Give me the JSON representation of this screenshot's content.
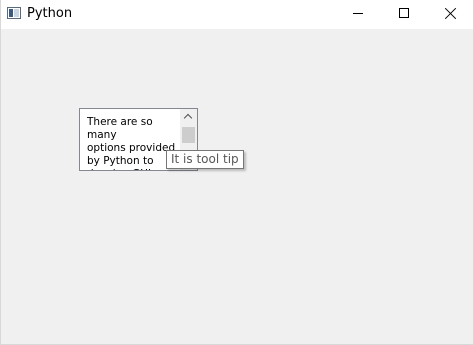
{
  "window": {
    "title": "Python",
    "icon": "window-app-icon"
  },
  "titlebar_controls": {
    "minimize_icon": "minimize-icon",
    "maximize_icon": "maximize-icon",
    "close_icon": "close-icon"
  },
  "textbox": {
    "text": "There are so many\noptions provided\nby Python to\ndevelop GUI\nTk",
    "scroll_up_icon": "chevron-up-icon"
  },
  "tooltip": {
    "text": "It is tool tip"
  }
}
